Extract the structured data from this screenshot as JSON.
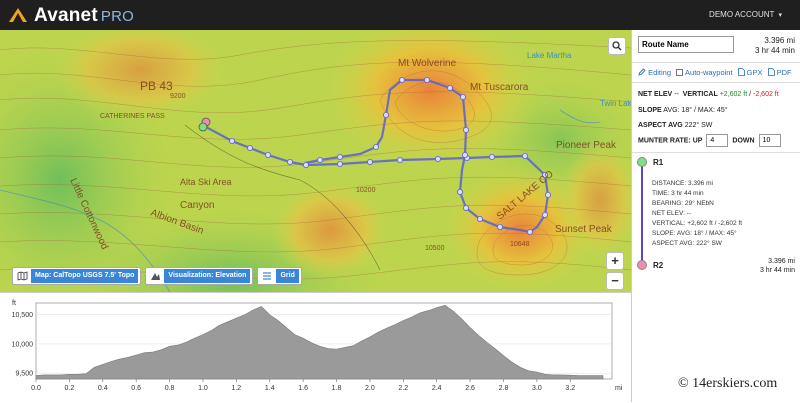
{
  "header": {
    "brand": "Avanet",
    "brand_suffix": "PRO",
    "account": "DEMO ACCOUNT",
    "account_caret": "▾"
  },
  "map": {
    "labels": [
      "PB 43",
      "Mt Wolverine",
      "Mt Tuscarora",
      "Little Cottonwood",
      "CATHERINES PASS",
      "Alta Ski Area",
      "Albion Basin",
      "Canyon",
      "Pioneer Peak",
      "Sunset Peak",
      "SALT LAKE CO",
      "Lake Martha",
      "Twin Lakes",
      "10500",
      "10648",
      "9200",
      "10200"
    ],
    "controls": [
      {
        "label": "Map: CalTopo USGS 7.5' Topo",
        "icon": "map-icon"
      },
      {
        "label": "Visualization: Elevation",
        "icon": "elevation-icon"
      },
      {
        "label": "Grid",
        "icon": "grid-icon"
      }
    ],
    "zoom_in": "+",
    "zoom_out": "−"
  },
  "sidebar": {
    "route_name": "Route Name",
    "distance": "3.396 mi",
    "time": "3 hr 44 min",
    "editing_label": "Editing",
    "auto_waypoint_label": "Auto-waypoint",
    "gpx_label": "GPX",
    "pdf_label": "PDF",
    "net_elev_label": "NET ELEV",
    "net_elev_value": "--",
    "vertical_label": "VERTICAL",
    "vertical_up": "+2,602 ft",
    "vertical_sep": "/",
    "vertical_down": "-2,602 ft",
    "slope_label": "SLOPE",
    "slope_value": "AVG: 18° / MAX: 45°",
    "aspect_label": "ASPECT AVG",
    "aspect_value": "222° SW",
    "munter_label": "MUNTER RATE: UP",
    "munter_up": "4",
    "down_label": "DOWN",
    "munter_down": "10",
    "waypoints": [
      {
        "name": "R1",
        "color": "#7ee07e"
      },
      {
        "name": "R2",
        "color": "#f08cb2"
      }
    ],
    "leg": {
      "distance": "DISTANCE: 3.396 mi",
      "time": "TIME: 3 hr 44 min",
      "bearing": "BEARING: 29° NEbN",
      "net_elev": "NET ELEV: --",
      "vertical": "VERTICAL: +2,602 ft / -2,602 ft",
      "slope": "SLOPE: AVG: 18° / MAX: 45°",
      "aspect": "ASPECT AVG: 222° SW"
    },
    "r2_distance": "3.396 mi",
    "r2_time": "3 hr 44 min"
  },
  "chart_data": {
    "type": "area",
    "x": [
      0,
      0.05,
      0.1,
      0.15,
      0.2,
      0.25,
      0.3,
      0.35,
      0.4,
      0.45,
      0.5,
      0.55,
      0.6,
      0.65,
      0.7,
      0.75,
      0.8,
      0.85,
      0.9,
      0.95,
      1.0,
      1.05,
      1.1,
      1.15,
      1.2,
      1.25,
      1.3,
      1.35,
      1.4,
      1.45,
      1.5,
      1.55,
      1.6,
      1.65,
      1.7,
      1.75,
      1.8,
      1.85,
      1.9,
      1.95,
      2.0,
      2.05,
      2.1,
      2.15,
      2.2,
      2.25,
      2.3,
      2.35,
      2.4,
      2.45,
      2.5,
      2.55,
      2.6,
      2.65,
      2.7,
      2.75,
      2.8,
      2.85,
      2.9,
      2.95,
      3.0,
      3.05,
      3.1,
      3.15,
      3.2,
      3.25,
      3.3,
      3.35,
      3.396
    ],
    "y": [
      9460,
      9470,
      9470,
      9470,
      9480,
      9480,
      9490,
      9600,
      9650,
      9700,
      9740,
      9770,
      9810,
      9850,
      9860,
      9900,
      9960,
      9980,
      10030,
      10100,
      10160,
      10230,
      10320,
      10380,
      10440,
      10500,
      10580,
      10640,
      10500,
      10400,
      10280,
      10160,
      10100,
      10020,
      9960,
      9920,
      9910,
      9940,
      9970,
      10050,
      10120,
      10200,
      10270,
      10330,
      10400,
      10460,
      10530,
      10570,
      10620,
      10660,
      10560,
      10430,
      10280,
      10150,
      10030,
      9920,
      9800,
      9690,
      9600,
      9540,
      9520,
      9480,
      9470,
      9470,
      9465,
      9460,
      9460,
      9460,
      9460
    ],
    "xlabel": "mi",
    "ylabel": "ft",
    "x_ticks": [
      0,
      0.2,
      0.4,
      0.6,
      0.8,
      1.0,
      1.2,
      1.4,
      1.6,
      1.8,
      2.0,
      2.2,
      2.4,
      2.6,
      2.8,
      3.0,
      3.2
    ],
    "y_ticks": [
      9500,
      10000,
      10500
    ],
    "y_tick_labels": [
      "9,500",
      "10,000",
      "10,500"
    ],
    "xlim": [
      0,
      3.45
    ],
    "ylim": [
      9400,
      10700
    ],
    "fill_color": "#9a9a9a"
  },
  "watermark": "© 14erskiers.com"
}
